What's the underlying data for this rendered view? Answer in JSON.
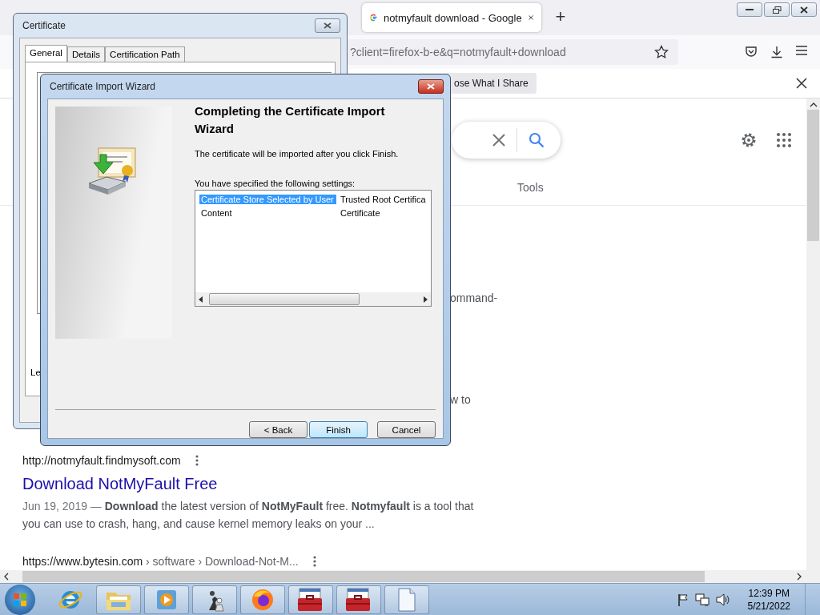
{
  "browser": {
    "tabs": [
      {
        "title": "notmyfault download - Google",
        "selected": true
      }
    ],
    "new_tab": "+",
    "address": "?client=firefox-b-e&q=notmyfault+download",
    "notification": {
      "button": "ose What I Share"
    }
  },
  "search_page": {
    "tools": "Tools",
    "fragments": [
      "ommand-",
      "w to"
    ],
    "results": [
      {
        "url": "http://notmyfault.findmysoft.com",
        "title": "Download NotMyFault Free",
        "date": "Jun 19, 2019 — ",
        "snippet": "**Download** the latest version of **NotMyFault** free. **Notmyfault** is a tool that you can use to crash, hang, and cause kernel memory leaks on your ..."
      },
      {
        "url": "https://www.bytesin.com",
        "breadcrumb": " › software › Download-Not-M..."
      }
    ]
  },
  "certificate_window": {
    "title": "Certificate",
    "tabs": [
      {
        "label": "General",
        "selected": true
      },
      {
        "label": "Details",
        "selected": false
      },
      {
        "label": "Certification Path",
        "selected": false
      }
    ],
    "fragment": "Le"
  },
  "wizard": {
    "title": "Certificate Import Wizard",
    "heading": "Completing the Certificate Import Wizard",
    "message": "The certificate will be imported after you click Finish.",
    "settings_label": "You have specified the following settings:",
    "settings": [
      {
        "name": "Certificate Store Selected by User",
        "value": "Trusted Root Certifica",
        "selected": true
      },
      {
        "name": "Content",
        "value": "Certificate",
        "selected": false
      }
    ],
    "buttons": [
      {
        "label": "< Back",
        "hovered": false
      },
      {
        "label": "Finish",
        "hovered": true
      },
      {
        "label": "Cancel",
        "hovered": false
      }
    ]
  },
  "taskbar": {
    "apps": [
      {
        "kind": "ie"
      },
      {
        "kind": "folder"
      },
      {
        "kind": "media"
      },
      {
        "kind": "chess"
      },
      {
        "kind": "browser"
      },
      {
        "kind": "toolbox"
      },
      {
        "kind": "toolbox"
      },
      {
        "kind": "document"
      }
    ],
    "clock": {
      "time": "12:39 PM",
      "date": "5/21/2022"
    }
  }
}
